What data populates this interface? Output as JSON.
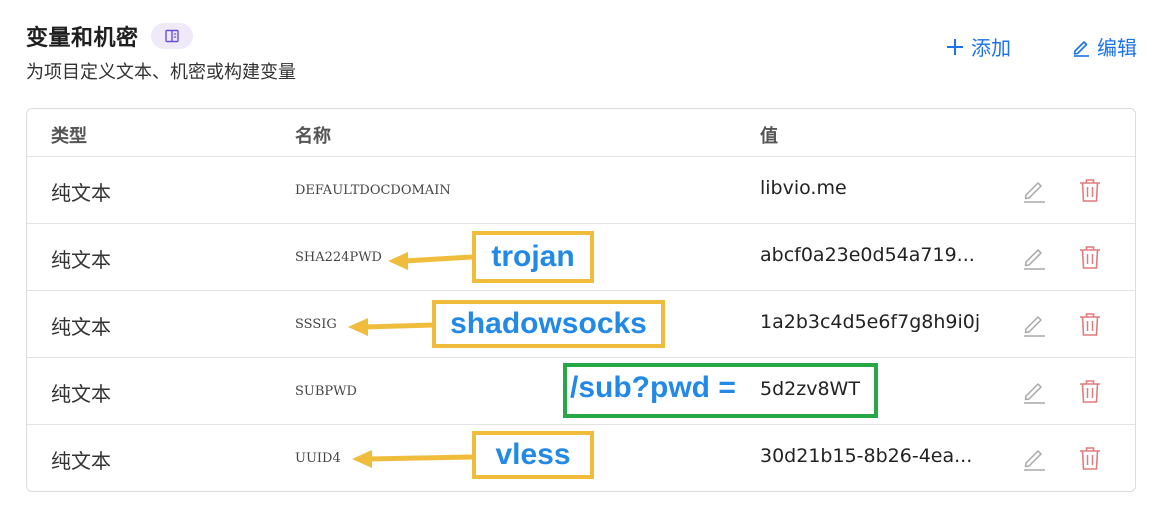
{
  "header": {
    "title": "变量和机密",
    "subtitle": "为项目定义文本、机密或构建变量",
    "add_label": "添加",
    "edit_label": "编辑"
  },
  "table": {
    "columns": [
      "类型",
      "名称",
      "值"
    ],
    "rows": [
      {
        "type": "纯文本",
        "name": "DEFAULTDOCDOMAIN",
        "value": "libvio.me"
      },
      {
        "type": "纯文本",
        "name": "SHA224PWD",
        "value": "abcf0a23e0d54a719..."
      },
      {
        "type": "纯文本",
        "name": "SSSIG",
        "value": "1a2b3c4d5e6f7g8h9i0j"
      },
      {
        "type": "纯文本",
        "name": "SUBPWD",
        "value": "5d2zv8WT"
      },
      {
        "type": "纯文本",
        "name": "UUID4",
        "value": "30d21b15-8b26-4ea..."
      }
    ]
  },
  "annotations": {
    "trojan": "trojan",
    "shadowsocks": "shadowsocks",
    "subpwd": "/sub?pwd ="
  },
  "colors": {
    "accent": "#1a73e8",
    "delete": "#e07b7b",
    "callout_yellow": "#f0bc3c",
    "callout_green": "#25a845",
    "callout_text": "#2289e6"
  },
  "icons": {
    "badge": "book-icon",
    "add": "plus-icon",
    "edit": "pencil-icon",
    "row_edit": "pencil-icon",
    "row_delete": "trash-icon"
  }
}
